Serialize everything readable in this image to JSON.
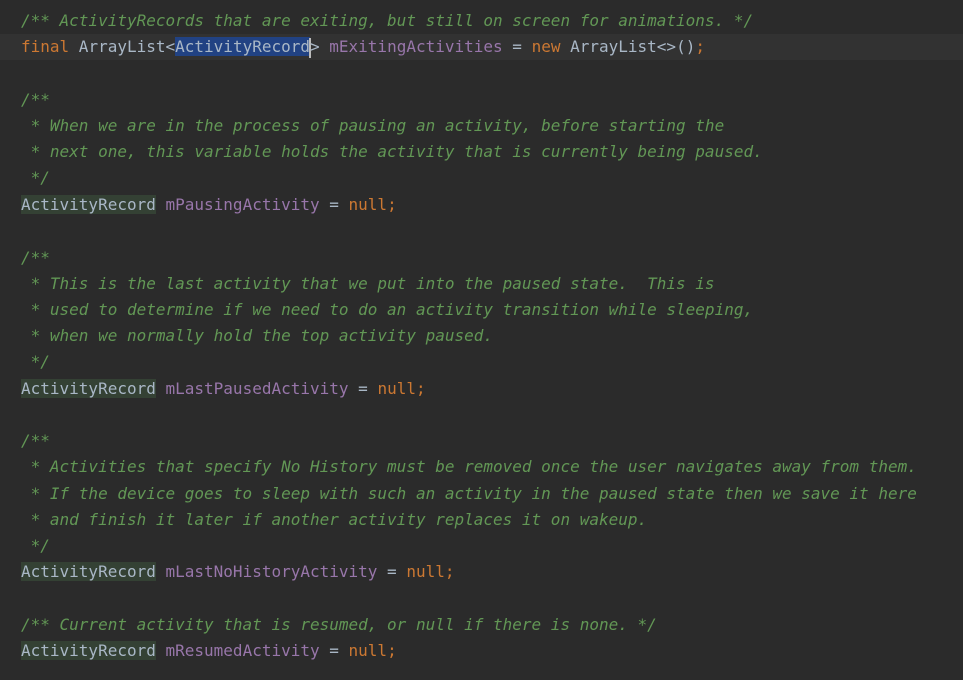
{
  "editor": {
    "language": "Java",
    "colors": {
      "background": "#2b2b2b",
      "current_line": "#323232",
      "comment": "#629755",
      "keyword": "#cc7832",
      "field": "#9876aa",
      "text": "#a9b7c6",
      "selection": "#214283",
      "usage_highlight": "#344134"
    },
    "line1": {
      "comment": "/** ActivityRecords that are exiting, but still on screen for animations. */"
    },
    "line2": {
      "kw_final": "final",
      "type_prefix": " ArrayList<",
      "selected_type": "ActivityRecord",
      "type_suffix": "> ",
      "field": "mExitingActivities",
      "eq": " = ",
      "kw_new": "new",
      "ctor": " ArrayList<>()",
      "semi": ";"
    },
    "block1": {
      "c1": "/**",
      "c2": " * When we are in the process of pausing an activity, before starting the",
      "c3": " * next one, this variable holds the activity that is currently being paused.",
      "c4": " */",
      "type": "ActivityRecord",
      "field": "mPausingActivity",
      "eq": " = ",
      "kw_null": "null",
      "semi": ";"
    },
    "block2": {
      "c1": "/**",
      "c2": " * This is the last activity that we put into the paused state.  This is",
      "c3": " * used to determine if we need to do an activity transition while sleeping,",
      "c4": " * when we normally hold the top activity paused.",
      "c5": " */",
      "type": "ActivityRecord",
      "field": "mLastPausedActivity",
      "eq": " = ",
      "kw_null": "null",
      "semi": ";"
    },
    "block3": {
      "c1": "/**",
      "c2": " * Activities that specify No History must be removed once the user navigates away from them.",
      "c3": " * If the device goes to sleep with such an activity in the paused state then we save it here",
      "c4": " * and finish it later if another activity replaces it on wakeup.",
      "c5": " */",
      "type": "ActivityRecord",
      "field": "mLastNoHistoryActivity",
      "eq": " = ",
      "kw_null": "null",
      "semi": ";"
    },
    "block4": {
      "comment": "/** Current activity that is resumed, or null if there is none. */",
      "type": "ActivityRecord",
      "field": "mResumedActivity",
      "eq": " = ",
      "kw_null": "null",
      "semi": ";"
    }
  }
}
